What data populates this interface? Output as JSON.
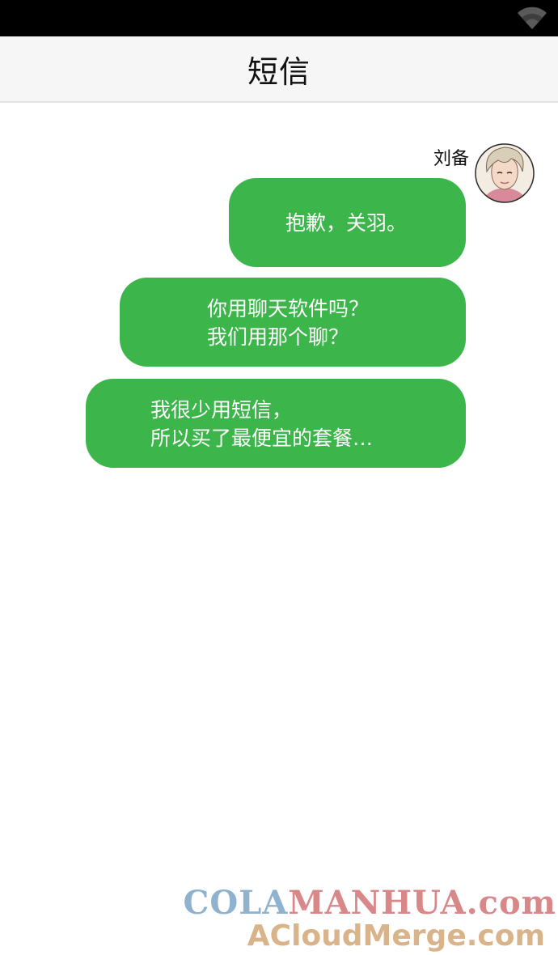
{
  "status_bar": {
    "icons": [
      "wifi-icon"
    ],
    "background": "#000000"
  },
  "header": {
    "title": "短信"
  },
  "conversation": {
    "sender": {
      "name": "刘备",
      "avatar": "avatar-portrait"
    },
    "bubble_color": "#3cb54b",
    "messages": [
      {
        "lines": [
          "抱歉，关羽。"
        ]
      },
      {
        "lines": [
          "你用聊天软件吗？",
          "我们用那个聊？"
        ]
      },
      {
        "lines": [
          "我很少用短信，",
          "所以买了最便宜的套餐…"
        ]
      }
    ]
  },
  "watermark": {
    "part1": "COLA",
    "part2": "MANHUA.com",
    "line2": "ACloudMerge.com"
  }
}
